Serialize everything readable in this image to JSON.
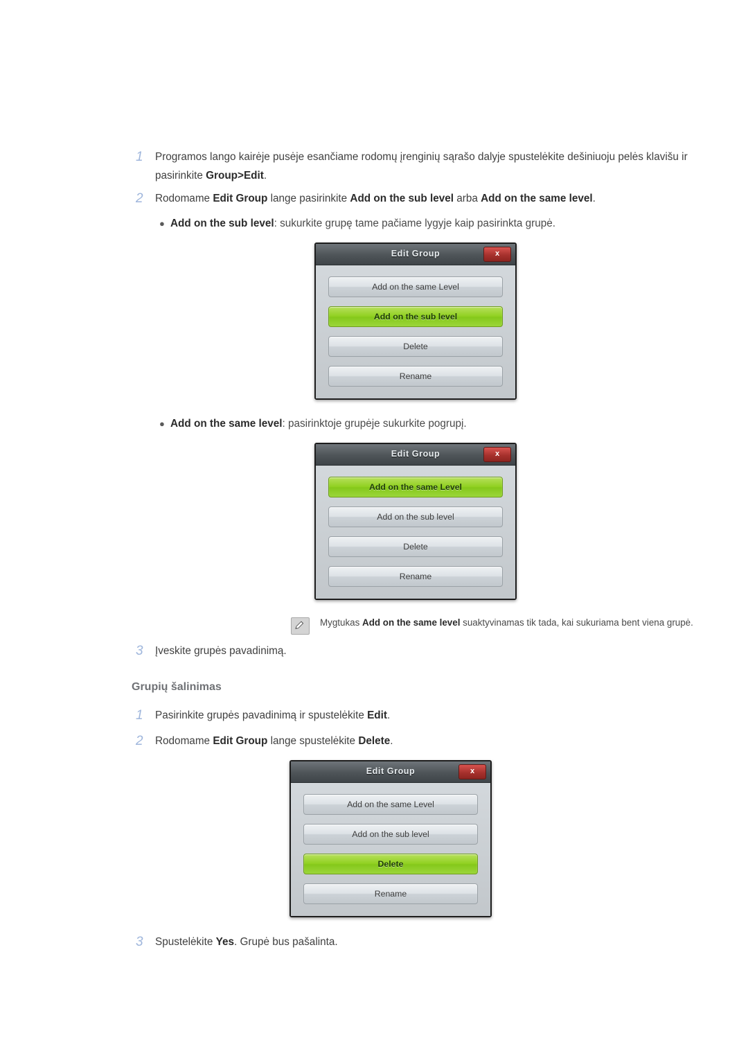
{
  "steps_top": [
    {
      "num": "1",
      "html": "Programos lango kairėje pusėje esančiame rodomų įrenginių sąrašo dalyje spustelėkite dešiniuoju pelės klavišu ir pasirinkite <b>Group&gt;Edit</b>."
    },
    {
      "num": "2",
      "html": "Rodomame <b>Edit Group</b> lange pasirinkite <b>Add on the sub level</b> arba <b>Add on the same level</b>."
    }
  ],
  "bullet1": {
    "dot": "●",
    "html": "<b>Add on the sub level</b>: sukurkite grupę tame pačiame lygyje kaip pasirinkta grupė."
  },
  "bullet2": {
    "dot": "●",
    "html": "<b>Add on the same level</b>: pasirinktoje grupėje sukurkite pogrupį."
  },
  "dialog1": {
    "title": "Edit Group",
    "close": "x",
    "buttons": [
      {
        "label": "Add on the same Level",
        "active": false
      },
      {
        "label": "Add on the sub level",
        "active": true
      },
      {
        "label": "Delete",
        "active": false
      },
      {
        "label": "Rename",
        "active": false
      }
    ]
  },
  "dialog2": {
    "title": "Edit Group",
    "close": "x",
    "buttons": [
      {
        "label": "Add on the same Level",
        "active": true
      },
      {
        "label": "Add on the sub level",
        "active": false
      },
      {
        "label": "Delete",
        "active": false
      },
      {
        "label": "Rename",
        "active": false
      }
    ]
  },
  "dialog3": {
    "title": "Edit Group",
    "close": "x",
    "buttons": [
      {
        "label": "Add on the same Level",
        "active": false
      },
      {
        "label": "Add on the sub level",
        "active": false
      },
      {
        "label": "Delete",
        "active": true
      },
      {
        "label": "Rename",
        "active": false
      }
    ]
  },
  "note": {
    "icon": "note-pencil-icon",
    "html": "Mygtukas <b>Add on the same level</b> suaktyvinamas tik tada, kai sukuriama bent viena grupė."
  },
  "step3": {
    "num": "3",
    "html": "Įveskite grupės pavadinimą."
  },
  "section": {
    "heading": "Grupių šalinimas"
  },
  "steps_bottom": [
    {
      "num": "1",
      "html": "Pasirinkite grupės pavadinimą ir spustelėkite <b>Edit</b>."
    },
    {
      "num": "2",
      "html": "Rodomame <b>Edit Group</b> lange spustelėkite <b>Delete</b>."
    }
  ],
  "step3b": {
    "num": "3",
    "html": "Spustelėkite <b>Yes</b>. Grupė bus pašalinta."
  },
  "colors": {
    "step_number": "#9fb6dc",
    "heading": "#6f7175",
    "body_text": "#3f3f3f",
    "dialog_accent_green": "#8fd01f",
    "dialog_close_red": "#a7312d"
  }
}
